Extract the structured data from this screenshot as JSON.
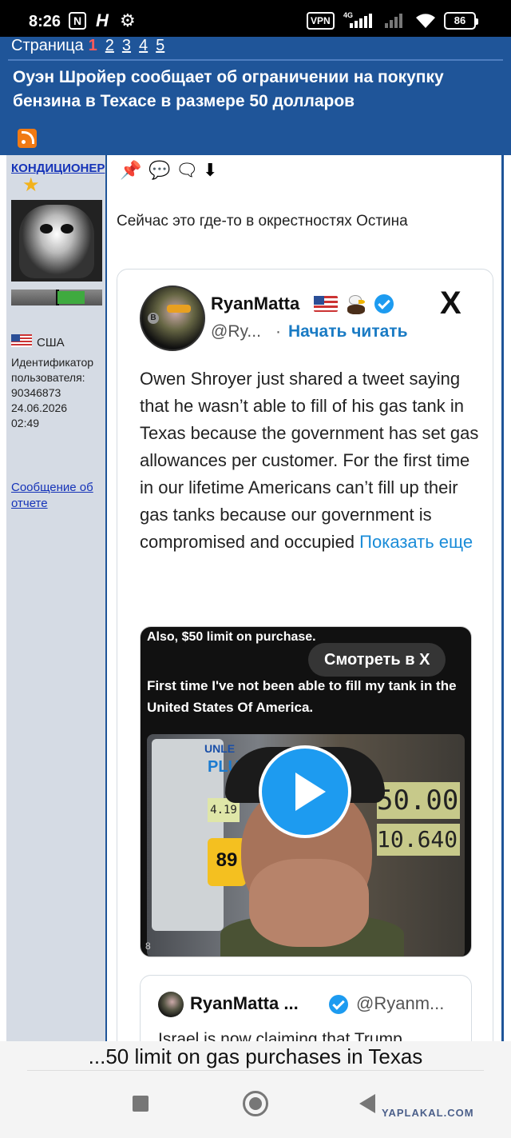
{
  "status_bar": {
    "time": "8:26",
    "nfc_label": "N",
    "vpn_label": "VPN",
    "network_label": "4G",
    "battery": "86"
  },
  "header": {
    "pager_label": "Страница",
    "current_page": "1",
    "pages": [
      "2",
      "3",
      "4",
      "5"
    ],
    "title": "Оуэн Шройер сообщает об ограничении на покупку бензина в Техасе в размере 50 долларов"
  },
  "user": {
    "username": "КОНДИЦИОНЕР",
    "country": "США",
    "id_label": "Идентификатор пользователя:",
    "id_value": "90346873",
    "date": "24.06.2026",
    "time": "02:49",
    "report_link": "Сообщение об отчете",
    "reputation_fraction": 0.3
  },
  "post": {
    "text": "Сейчас это где-то в окрестностях Остина"
  },
  "tweet": {
    "name": "RyanMatta",
    "handle": "@Ry...",
    "follow_label": "Начать читать",
    "x_logo": "X",
    "body": "Owen Shroyer just shared a tweet saying that he wasn’t able to fill of his gas tank in Texas because the government has set gas allowances per customer. For the first time in our lifetime Americans can’t fill up their gas tanks because our government is compromised and occupied",
    "show_more": "Показать еще",
    "media": {
      "caption1": "Also, $50 limit on purchase.",
      "caption2": "First time I've not been able to fill my tank in the United States Of America.",
      "watch_label": "Смотреть в X",
      "pump_unl": "UNLE",
      "pump_plu": "PLU",
      "pump_price": "4.19",
      "pump_octane": "89",
      "display_amount": "50.00",
      "display_gallons": "10.640",
      "corner": "8"
    },
    "quote": {
      "name": "RyanMatta ...",
      "handle": "@Ryanm...",
      "text": "Israel is now claiming that Trump"
    }
  },
  "footer": {
    "caption": "...50 limit on gas purchases in Texas",
    "watermark": "YAPLAKAL.COM"
  },
  "colors": {
    "header_blue": "#1f5599",
    "link_blue": "#1533b8",
    "twitter_blue": "#1d9bf0"
  }
}
